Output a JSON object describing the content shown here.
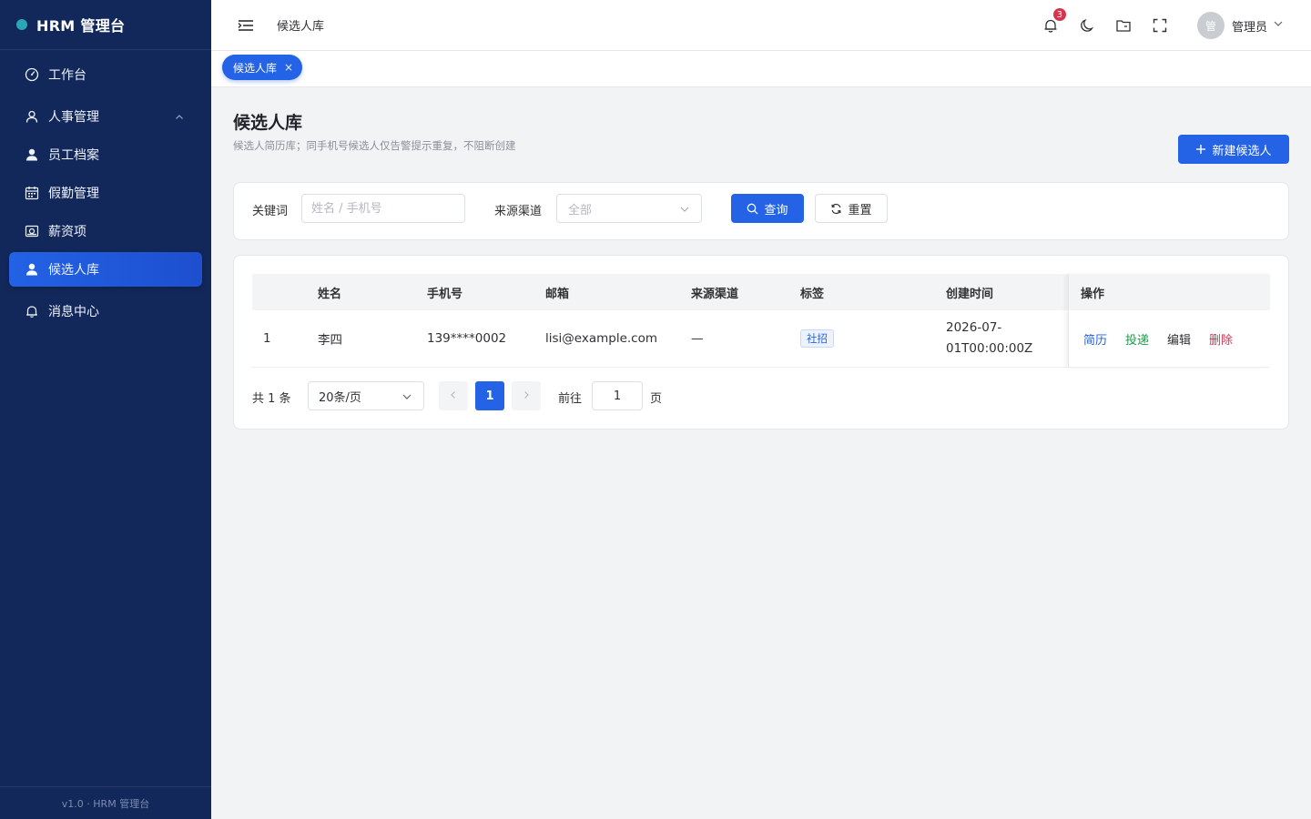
{
  "brand": {
    "title": "HRM 管理台",
    "dot_color": "#2aa6b8"
  },
  "sidebar": {
    "items": [
      {
        "label": "工作台",
        "icon": "dashboard-icon"
      },
      {
        "label": "人事管理",
        "icon": "user-outline-icon",
        "expanded": true
      },
      {
        "label": "员工档案",
        "icon": "user-solid-icon"
      },
      {
        "label": "假勤管理",
        "icon": "calendar-icon"
      },
      {
        "label": "薪资项",
        "icon": "money-icon"
      },
      {
        "label": "候选人库",
        "icon": "user-solid-icon",
        "active": true
      },
      {
        "label": "消息中心",
        "icon": "bell-icon"
      }
    ],
    "footer": "v1.0 · HRM 管理台"
  },
  "header": {
    "title": "候选人库",
    "notifications_count": "3",
    "user": {
      "avatar_text": "管",
      "name": "管理员"
    }
  },
  "tabs": [
    {
      "label": "候选人库",
      "close": "×"
    }
  ],
  "page": {
    "title": "候选人库",
    "subtitle": "候选人简历库；同手机号候选人仅告警提示重复，不阻断创建",
    "new_button": "新建候选人"
  },
  "filter": {
    "keyword_label": "关键词",
    "keyword_placeholder": "姓名 / 手机号",
    "keyword_value": "",
    "source_label": "来源渠道",
    "source_value": "全部",
    "search_button": "查询",
    "reset_button": "重置"
  },
  "table": {
    "headers": [
      "",
      "姓名",
      "手机号",
      "邮箱",
      "来源渠道",
      "标签",
      "创建时间",
      "操作"
    ],
    "rows": [
      {
        "index": "1",
        "name": "李四",
        "phone": "139****0002",
        "email": "lisi@example.com",
        "source": "—",
        "tag": "社招",
        "created_line1": "2026-07-",
        "created_line2": "01T00:00:00Z",
        "actions": {
          "resume": "简历",
          "deliver": "投递",
          "edit": "编辑",
          "delete": "删除"
        }
      }
    ]
  },
  "pagination": {
    "total": "共 1 条",
    "page_size": "20条/页",
    "current": "1",
    "goto_label": "前往",
    "goto_value": "1",
    "goto_unit": "页"
  },
  "colors": {
    "sidebar_bg": "#13285a",
    "primary": "#2463e6",
    "action_resume": "#2463e6",
    "action_deliver": "#1a9a4a",
    "action_edit": "#303133",
    "action_delete": "#d6334d",
    "badge": "#d6334d"
  }
}
